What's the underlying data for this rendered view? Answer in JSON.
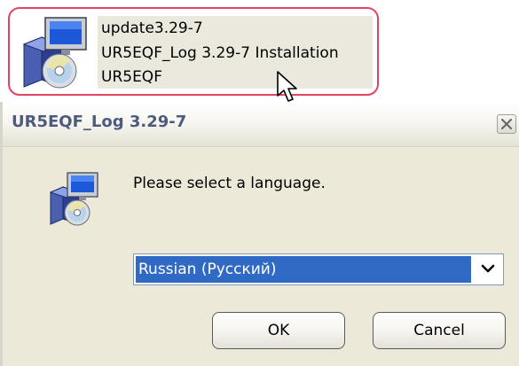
{
  "tile": {
    "name": "update3.29-7",
    "description": "UR5EQF_Log 3.29-7 Installation",
    "company": "UR5EQF",
    "icon": "installer-package-icon"
  },
  "dialog": {
    "title": "UR5EQF_Log 3.29-7",
    "prompt": "Please select a language.",
    "icon": "installer-package-icon",
    "language_selected": "Russian (Русский)",
    "ok_label": "OK",
    "cancel_label": "Cancel"
  },
  "colors": {
    "tile_highlight_border": "#e0465f",
    "selection_blue": "#316ac5",
    "dialog_bg": "#ece9d8",
    "title_text": "#4d5b7f"
  }
}
